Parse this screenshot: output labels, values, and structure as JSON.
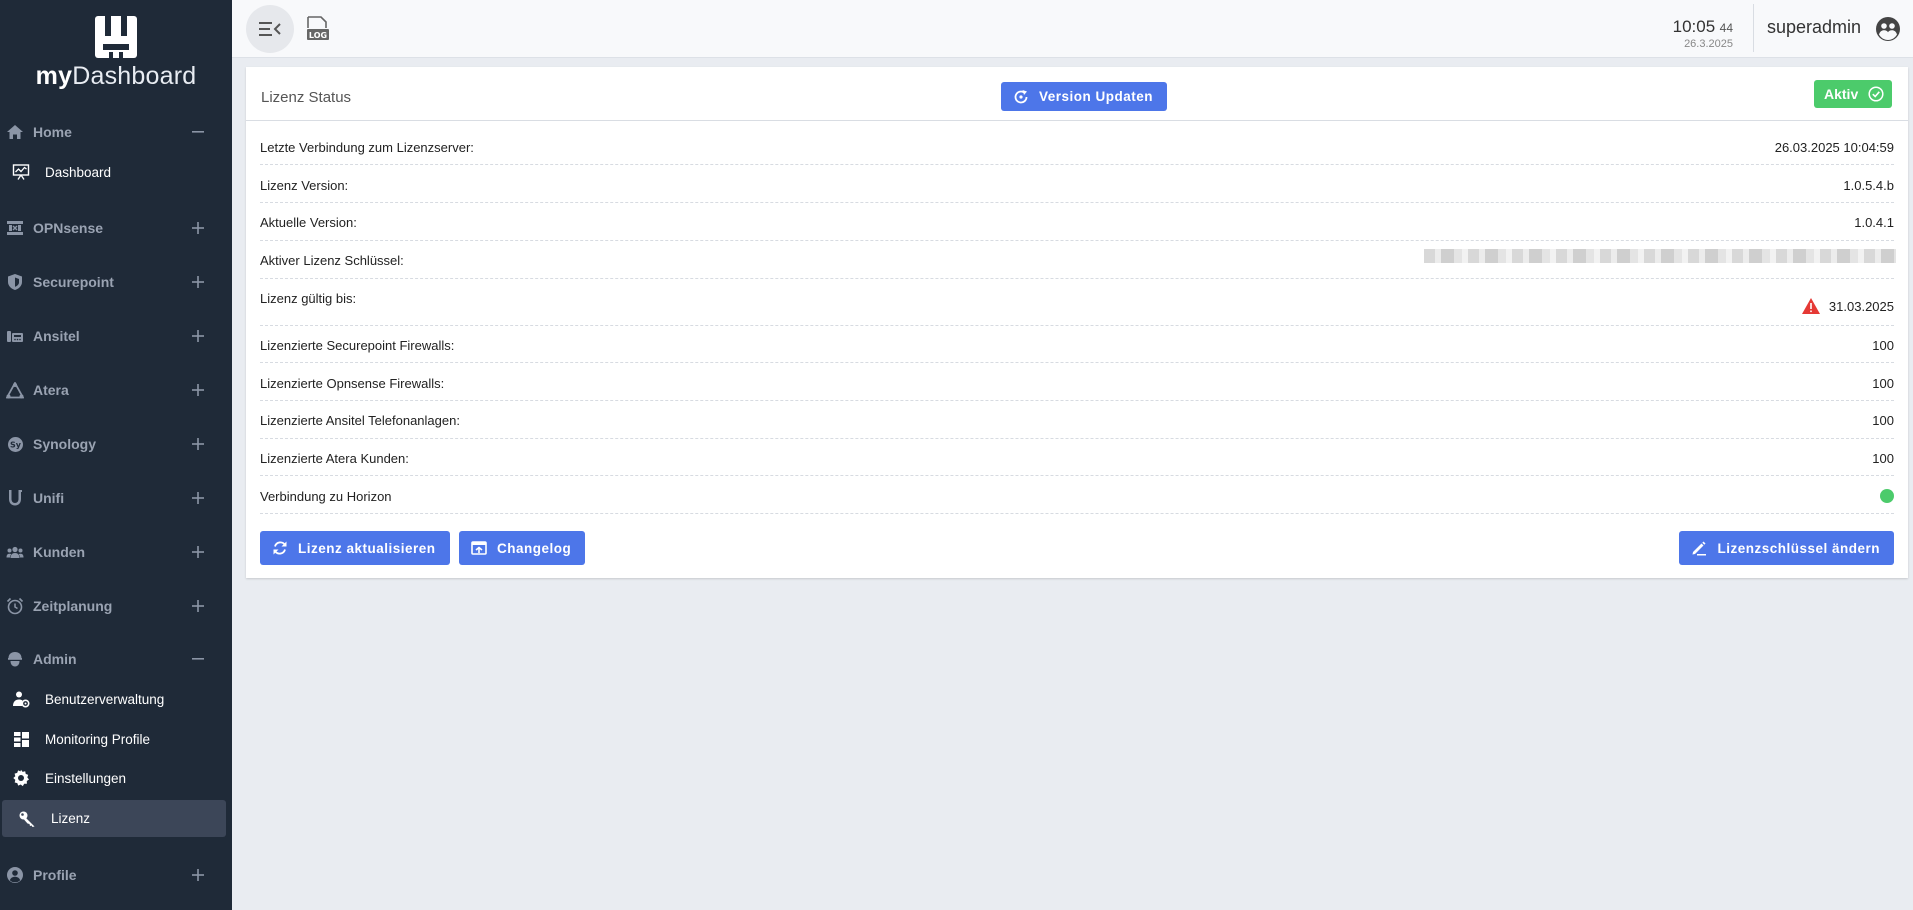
{
  "app": {
    "logo_bold": "my",
    "logo_light": "Dashboard"
  },
  "sidebar": {
    "sections": [
      {
        "label": "Home",
        "icon": "home-icon",
        "expanded": true
      },
      {
        "label": "OPNsense",
        "icon": "opnsense-icon",
        "expanded": false
      },
      {
        "label": "Securepoint",
        "icon": "shield-icon",
        "expanded": false
      },
      {
        "label": "Ansitel",
        "icon": "phone-icon",
        "expanded": false
      },
      {
        "label": "Atera",
        "icon": "atera-icon",
        "expanded": false
      },
      {
        "label": "Synology",
        "icon": "synology-icon",
        "expanded": false
      },
      {
        "label": "Unifi",
        "icon": "unifi-icon",
        "expanded": false
      },
      {
        "label": "Kunden",
        "icon": "users-icon",
        "expanded": false
      },
      {
        "label": "Zeitplanung",
        "icon": "alarm-clock-icon",
        "expanded": false
      },
      {
        "label": "Admin",
        "icon": "admin-icon",
        "expanded": true
      },
      {
        "label": "Profile",
        "icon": "profile-icon",
        "expanded": false
      }
    ],
    "home_items": [
      {
        "label": "Dashboard",
        "icon": "dashboard-icon"
      }
    ],
    "admin_items": [
      {
        "label": "Benutzerverwaltung",
        "icon": "user-settings-icon"
      },
      {
        "label": "Monitoring Profile",
        "icon": "grid-icon"
      },
      {
        "label": "Einstellungen",
        "icon": "gear-icon"
      },
      {
        "label": "Lizenz",
        "icon": "key-icon",
        "active": true
      }
    ]
  },
  "topbar": {
    "time": "10:05",
    "seconds": "44",
    "date": "26.3.2025",
    "username": "superadmin"
  },
  "license": {
    "title": "Lizenz Status",
    "update_button": "Version Updaten",
    "status_badge": "Aktiv",
    "rows": [
      {
        "key": "Letzte Verbindung zum Lizenzserver:",
        "value": "26.03.2025 10:04:59"
      },
      {
        "key": "Lizenz Version:",
        "value": "1.0.5.4.b"
      },
      {
        "key": "Aktuelle Version:",
        "value": "1.0.4.1"
      },
      {
        "key": "Aktiver Lizenz Schlüssel:",
        "value": ""
      },
      {
        "key": "Lizenz gültig bis:",
        "value": "31.03.2025"
      },
      {
        "key": "Lizenzierte Securepoint Firewalls:",
        "value": "100"
      },
      {
        "key": "Lizenzierte Opnsense Firewalls:",
        "value": "100"
      },
      {
        "key": "Lizenzierte Ansitel Telefonanlagen:",
        "value": "100"
      },
      {
        "key": "Lizenzierte Atera Kunden:",
        "value": "100"
      },
      {
        "key": "Verbindung zu Horizon",
        "value": ""
      }
    ],
    "refresh_button": "Lizenz aktualisieren",
    "changelog_button": "Changelog",
    "change_key_button": "Lizenzschlüssel ändern"
  },
  "colors": {
    "sidebar_bg": "#1f2a38",
    "primary": "#4d76e9",
    "success": "#4ccb6b",
    "warning": "#e53935"
  }
}
